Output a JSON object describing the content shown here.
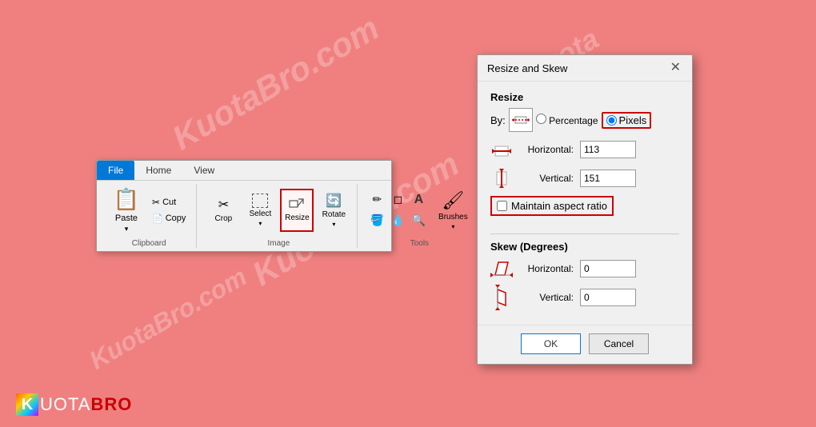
{
  "background_color": "#f08080",
  "watermarks": [
    "KuotaBro.com",
    "KuotaBro.com",
    "Kuota",
    "KuotaBro.com"
  ],
  "paint_window": {
    "tabs": [
      {
        "label": "File",
        "active": true
      },
      {
        "label": "Home",
        "active": false
      },
      {
        "label": "View",
        "active": false
      }
    ],
    "clipboard_group": {
      "label": "Clipboard",
      "paste_label": "Paste",
      "paste_arrow": "▾",
      "cut_label": "Cut",
      "copy_label": "Copy"
    },
    "image_group": {
      "label": "Image",
      "crop_label": "Crop",
      "select_label": "Select",
      "select_arrow": "▾",
      "resize_label": "Resize",
      "rotate_label": "Rotate",
      "rotate_arrow": "▾"
    },
    "tools_group": {
      "label": "Tools",
      "brushes_label": "Brushes",
      "brushes_arrow": "▾"
    }
  },
  "dialog": {
    "title": "Resize and Skew",
    "close_label": "✕",
    "resize_section": {
      "label": "Resize",
      "by_label": "By:",
      "percentage_label": "Percentage",
      "pixels_label": "Pixels",
      "horizontal_label": "Horizontal:",
      "horizontal_value": "113",
      "vertical_label": "Vertical:",
      "vertical_value": "151",
      "maintain_aspect_label": "Maintain aspect ratio"
    },
    "skew_section": {
      "label": "Skew (Degrees)",
      "horizontal_label": "Horizontal:",
      "horizontal_value": "0",
      "vertical_label": "Vertical:",
      "vertical_value": "0"
    },
    "ok_label": "OK",
    "cancel_label": "Cancel"
  },
  "logo": {
    "k": "K",
    "uota": "UOTA",
    "bro": "BRO"
  }
}
